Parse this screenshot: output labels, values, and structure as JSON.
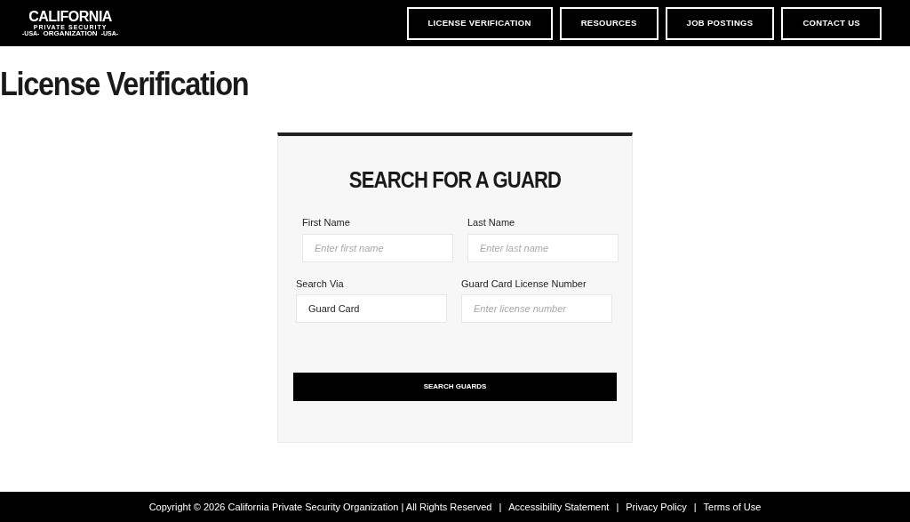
{
  "logo": {
    "line_1": "CALIFORNIA",
    "line_2": "PRIVATE SECURITY",
    "line_3_left": "-USA-",
    "line_3_main": "ORGANIZATION",
    "line_3_right": "-USA-"
  },
  "nav": [
    {
      "label": "LICENSE VERIFICATION"
    },
    {
      "label": "RESOURCES"
    },
    {
      "label": "JOB POSTINGS"
    },
    {
      "label": "CONTACT US"
    }
  ],
  "page_title": "License Verification",
  "form": {
    "title": "SEARCH FOR A GUARD",
    "rows": [
      [
        {
          "kind": "input",
          "label": "First Name",
          "placeholder": "Enter first name"
        },
        {
          "kind": "input",
          "label": "Last Name",
          "placeholder": "Enter last name"
        }
      ],
      [
        {
          "kind": "select",
          "label": "Search Via",
          "value": "Guard Card"
        },
        {
          "kind": "input",
          "label": "Guard Card License Number",
          "placeholder": "Enter license number"
        }
      ]
    ],
    "button": "SEARCH GUARDS"
  },
  "footer": {
    "separator": "|",
    "copyright": "Copyright © 2026 California Private Security Organization | All Rights Reserved",
    "links": [
      "Accessibility Statement",
      "Privacy Policy",
      "Terms of Use"
    ]
  }
}
